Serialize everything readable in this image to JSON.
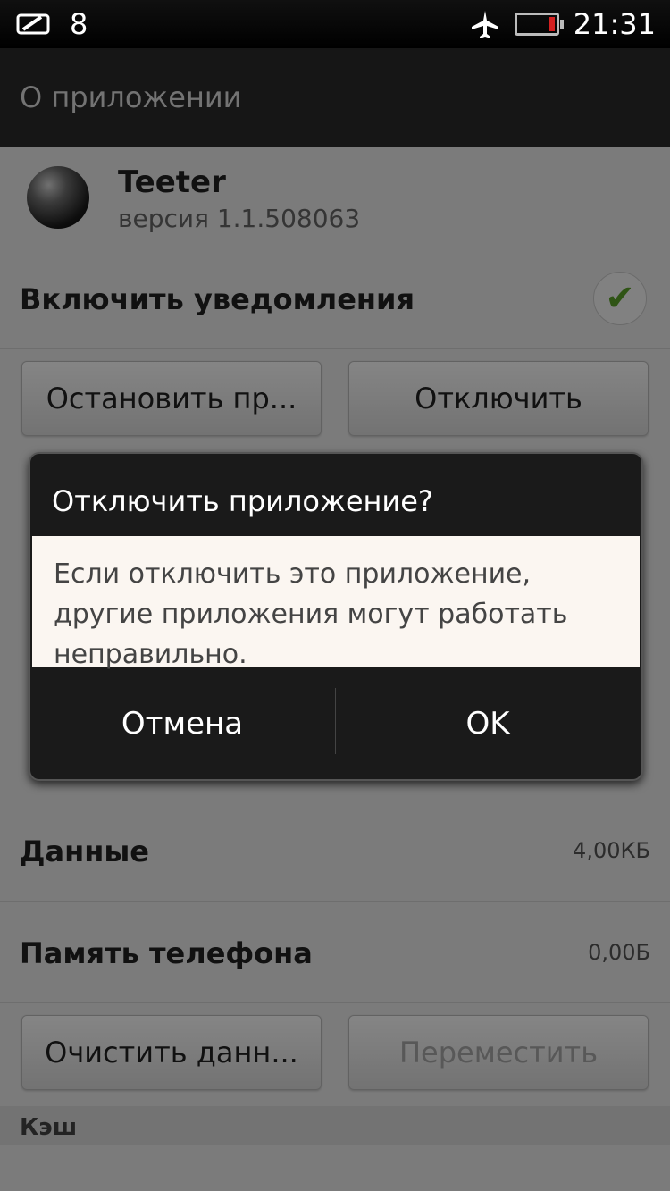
{
  "status_bar": {
    "notification_count": "8",
    "time": "21:31"
  },
  "title_bar": {
    "title": "О приложении"
  },
  "app": {
    "name": "Teeter",
    "version": "версия 1.1.508063"
  },
  "notifications": {
    "label": "Включить уведомления",
    "checked": true
  },
  "buttons": {
    "stop": "Остановить пр...",
    "disable": "Отключить",
    "clear_data": "Очистить данн...",
    "move": "Переместить"
  },
  "storage": [
    {
      "label": "Данные",
      "value": "4,00КБ"
    },
    {
      "label": "Память телефона",
      "value": "0,00Б"
    }
  ],
  "cache_section": {
    "title": "Кэш"
  },
  "dialog": {
    "title": "Отключить приложение?",
    "message": "Если отключить это приложение, другие приложения могут работать неправильно.",
    "cancel": "Отмена",
    "ok": "OK"
  }
}
